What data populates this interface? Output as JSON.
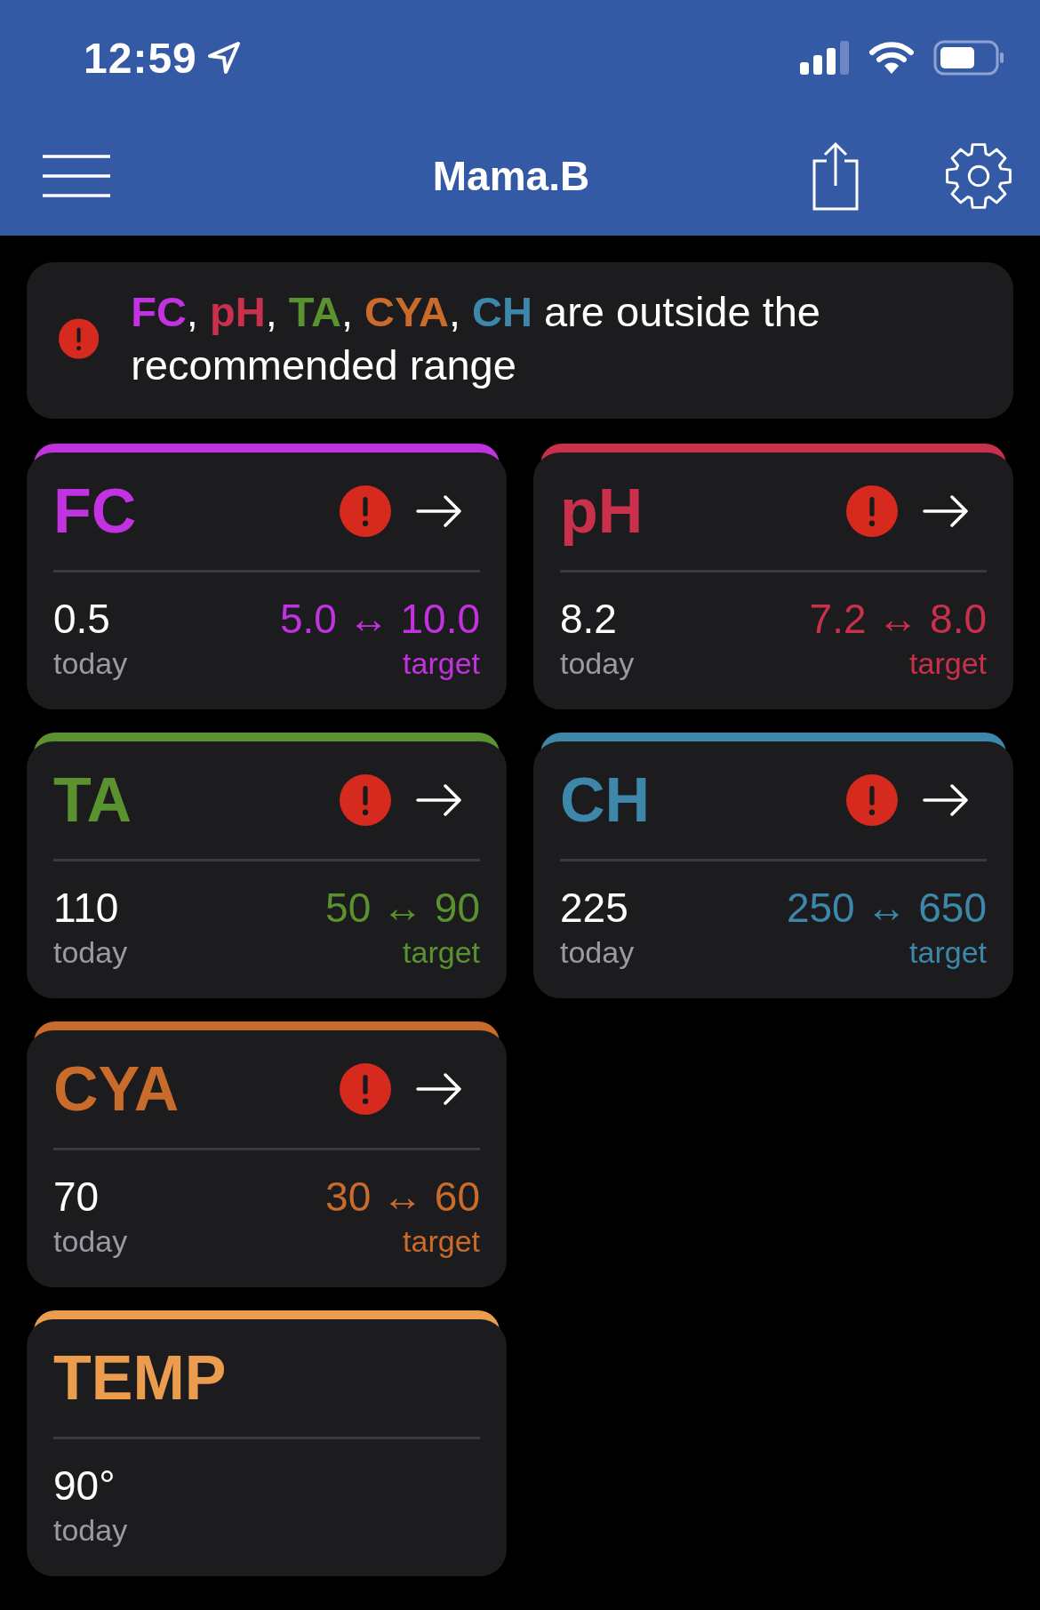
{
  "status_bar": {
    "time": "12:59"
  },
  "nav_bar": {
    "title": "Mama.B"
  },
  "alert_banner": {
    "parts": [
      {
        "text": "FC",
        "color": "#c232e0"
      },
      {
        "text": ", "
      },
      {
        "text": "pH",
        "color": "#c9304c"
      },
      {
        "text": ", "
      },
      {
        "text": "TA",
        "color": "#5b9230"
      },
      {
        "text": ", "
      },
      {
        "text": "CYA",
        "color": "#c96b2a"
      },
      {
        "text": ", "
      },
      {
        "text": "CH",
        "color": "#3d87aa"
      },
      {
        "text": " are outside the recommended range"
      }
    ]
  },
  "card_rows": [
    [
      {
        "name": "FC",
        "color": "#c232e0",
        "alert": true,
        "value": "0.5",
        "value_label": "today",
        "range": "5.0 ↔ 10.0",
        "range_label": "target"
      },
      {
        "name": "pH",
        "color": "#c9304c",
        "alert": true,
        "value": "8.2",
        "value_label": "today",
        "range": "7.2 ↔ 8.0",
        "range_label": "target"
      }
    ],
    [
      {
        "name": "TA",
        "color": "#5b9230",
        "alert": true,
        "value": "110",
        "value_label": "today",
        "range": "50 ↔ 90",
        "range_label": "target"
      },
      {
        "name": "CH",
        "color": "#3d87aa",
        "alert": true,
        "value": "225",
        "value_label": "today",
        "range": "250 ↔ 650",
        "range_label": "target"
      }
    ],
    [
      {
        "name": "CYA",
        "color": "#c96b2a",
        "alert": true,
        "value": "70",
        "value_label": "today",
        "range": "30 ↔ 60",
        "range_label": "target"
      }
    ],
    [
      {
        "name": "TEMP",
        "color": "#eb9c4c",
        "value": "90°",
        "value_label": "today"
      }
    ]
  ]
}
